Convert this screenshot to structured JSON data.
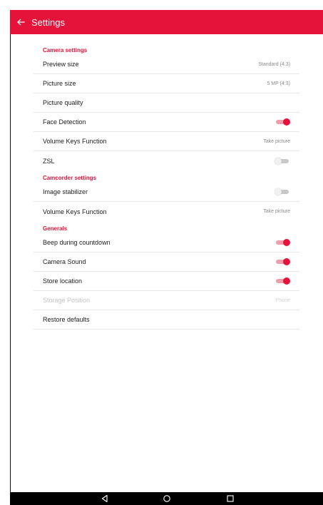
{
  "app_bar": {
    "title": "Settings",
    "background_color": "#e5133a",
    "back_icon": "arrow-left-icon"
  },
  "sections": [
    {
      "header": "Camera settings",
      "items": [
        {
          "label": "Preview size",
          "value": "Standard (4:3)"
        },
        {
          "label": "Picture size",
          "value": "5 MP (4:3)"
        },
        {
          "label": "Picture quality",
          "value": ""
        },
        {
          "label": "Face Detection",
          "toggle": true
        },
        {
          "label": "Volume Keys Function",
          "value": "Take picture"
        },
        {
          "label": "ZSL",
          "toggle": false
        }
      ]
    },
    {
      "header": "Camcorder settings",
      "items": [
        {
          "label": "Image stabilizer",
          "toggle": false
        },
        {
          "label": "Volume Keys Function",
          "value": "Take picture"
        }
      ]
    },
    {
      "header": "Generals",
      "items": [
        {
          "label": "Beep during countdown",
          "toggle": true
        },
        {
          "label": "Camera Sound",
          "toggle": true
        },
        {
          "label": "Store location",
          "toggle": true
        },
        {
          "label": "Storage Position",
          "value": "Phone",
          "disabled": true
        },
        {
          "label": "Restore defaults",
          "value": ""
        }
      ]
    }
  ],
  "nav_bar": {
    "back_icon": "triangle-back-icon",
    "home_icon": "circle-home-icon",
    "recents_icon": "square-recents-icon"
  },
  "colors": {
    "accent": "#e5133a",
    "toggle_track_on": "#f39aab",
    "toggle_track_off": "#c9c9c9"
  }
}
